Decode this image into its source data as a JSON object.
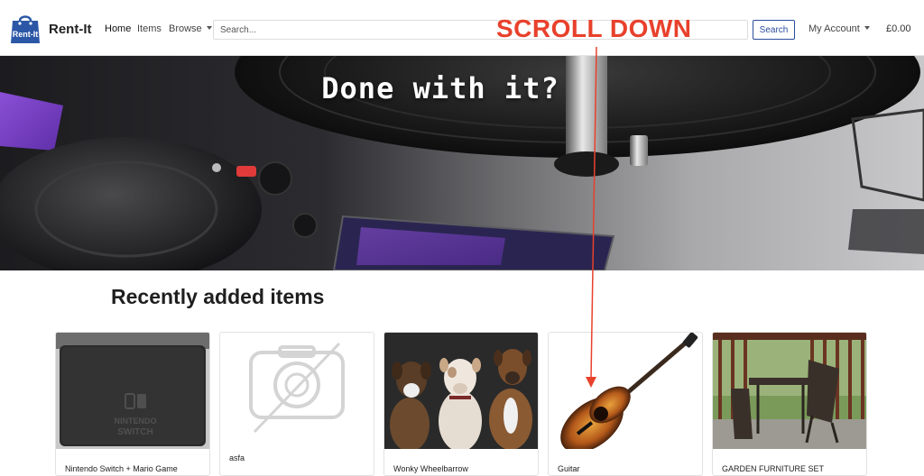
{
  "navbar": {
    "brand": "Rent-It",
    "logo_text": "Rent-It",
    "home": "Home",
    "items": "Items",
    "browse": "Browse",
    "search_placeholder": "Search...",
    "search_button": "Search",
    "account": "My Account",
    "cart_total": "£0.00"
  },
  "hero": {
    "title": "Done with it?"
  },
  "annotation": {
    "text": "SCROLL DOWN",
    "color": "#e8412c"
  },
  "recent": {
    "title": "Recently added items",
    "items": [
      {
        "name": "Nintendo Switch + Mario Game",
        "image": "nintendo-switch-dock"
      },
      {
        "name": "asfa",
        "image": "no-image-placeholder"
      },
      {
        "name": "Wonky Wheelbarrow",
        "image": "three-dogs"
      },
      {
        "name": "Guitar",
        "image": "acoustic-guitar"
      },
      {
        "name": "GARDEN FURNITURE SET",
        "image": "balcony-furniture"
      }
    ]
  },
  "colors": {
    "primary": "#2b4c9e",
    "annotation": "#e8412c",
    "logo_bag": "#2b57a6"
  }
}
